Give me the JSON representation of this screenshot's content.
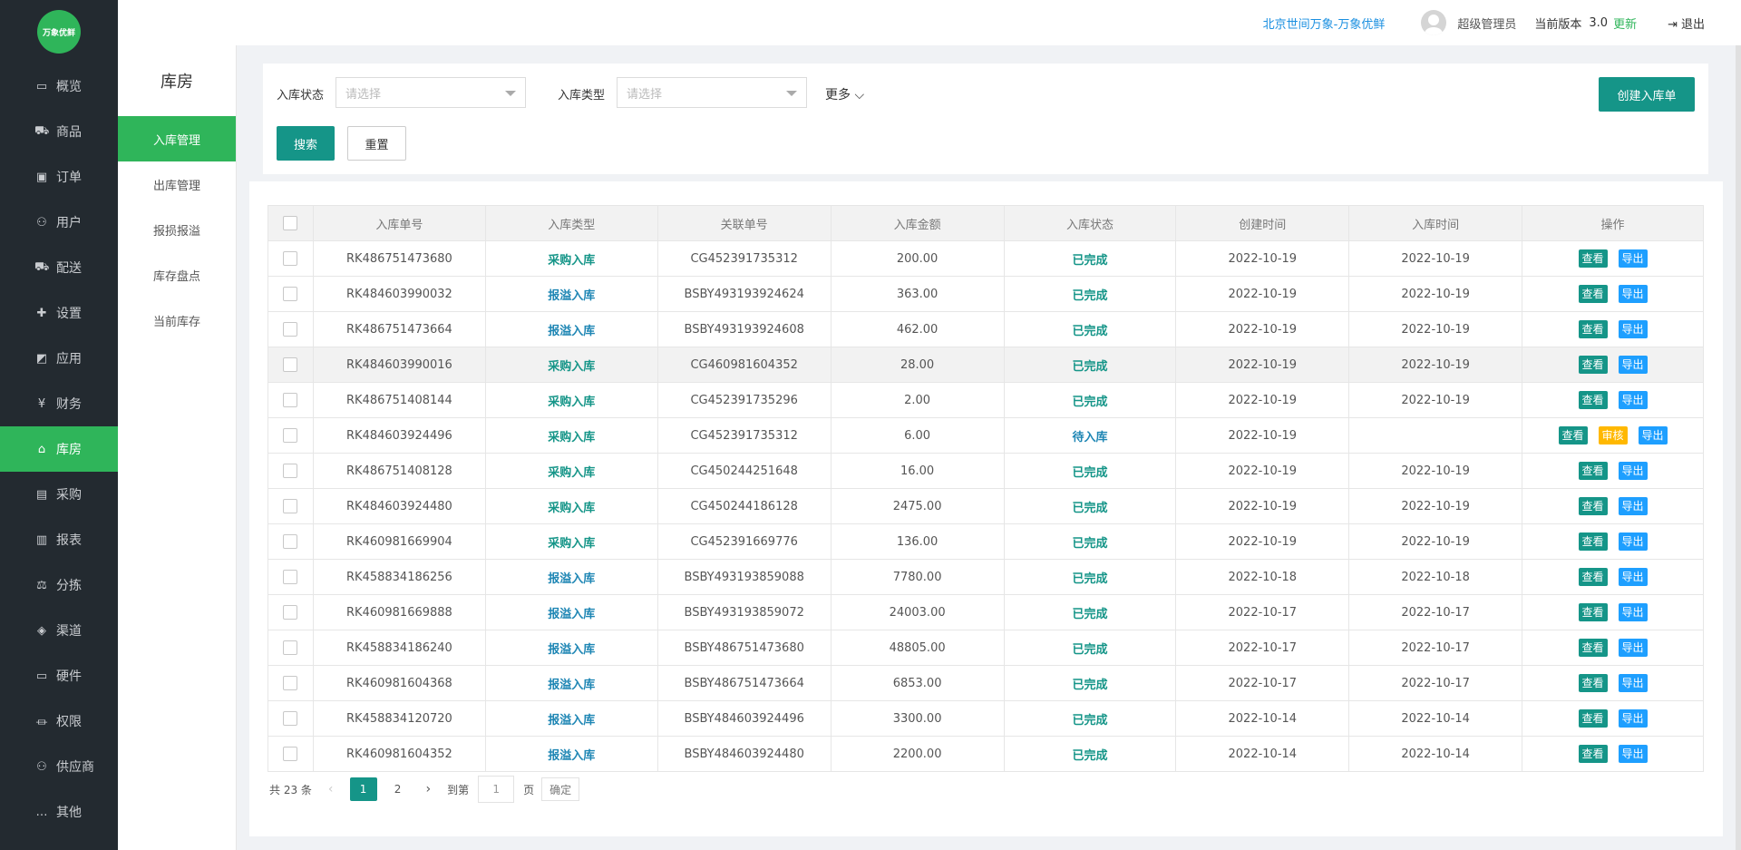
{
  "brand": {
    "logo_text": "万象优鲜"
  },
  "nav": [
    {
      "label": "概览",
      "icon": "monitor-icon"
    },
    {
      "label": "商品",
      "icon": "cart-icon"
    },
    {
      "label": "订单",
      "icon": "money-icon"
    },
    {
      "label": "用户",
      "icon": "users-icon"
    },
    {
      "label": "配送",
      "icon": "truck-icon"
    },
    {
      "label": "设置",
      "icon": "puzzle-icon"
    },
    {
      "label": "应用",
      "icon": "apps-icon"
    },
    {
      "label": "财务",
      "icon": "yen-icon"
    },
    {
      "label": "库房",
      "icon": "home-icon"
    },
    {
      "label": "采购",
      "icon": "bus-icon"
    },
    {
      "label": "报表",
      "icon": "bar-chart-icon"
    },
    {
      "label": "分拣",
      "icon": "scale-icon"
    },
    {
      "label": "渠道",
      "icon": "cube-icon"
    },
    {
      "label": "硬件",
      "icon": "desktop-icon"
    },
    {
      "label": "权限",
      "icon": "bank-icon"
    },
    {
      "label": "供应商",
      "icon": "users-icon"
    },
    {
      "label": "其他",
      "icon": "ellipsis-icon"
    }
  ],
  "subnav": {
    "title": "库房",
    "items": [
      "入库管理",
      "出库管理",
      "报损报溢",
      "库存盘点",
      "当前库存"
    ]
  },
  "header": {
    "org": "北京世间万象-万象优鲜",
    "user": "超级管理员",
    "version_label": "当前版本",
    "version": "3.0",
    "update": "更新",
    "logout": "退出"
  },
  "filters": {
    "status_label": "入库状态",
    "status_placeholder": "请选择",
    "type_label": "入库类型",
    "type_placeholder": "请选择",
    "more": "更多",
    "search": "搜索",
    "reset": "重置",
    "create": "创建入库单"
  },
  "table": {
    "headers": [
      "入库单号",
      "入库类型",
      "关联单号",
      "入库金额",
      "入库状态",
      "创建时间",
      "入库时间",
      "操作"
    ],
    "actions": {
      "view": "查看",
      "audit": "审核",
      "export": "导出"
    },
    "rows": [
      [
        "RK486751473680",
        "采购入库",
        "CG452391735312",
        "200.00",
        "已完成",
        "2022-10-19",
        "2022-10-19"
      ],
      [
        "RK484603990032",
        "报溢入库",
        "BSBY493193924624",
        "363.00",
        "已完成",
        "2022-10-19",
        "2022-10-19"
      ],
      [
        "RK486751473664",
        "报溢入库",
        "BSBY493193924608",
        "462.00",
        "已完成",
        "2022-10-19",
        "2022-10-19"
      ],
      [
        "RK484603990016",
        "采购入库",
        "CG460981604352",
        "28.00",
        "已完成",
        "2022-10-19",
        "2022-10-19"
      ],
      [
        "RK486751408144",
        "采购入库",
        "CG452391735296",
        "2.00",
        "已完成",
        "2022-10-19",
        "2022-10-19"
      ],
      [
        "RK484603924496",
        "采购入库",
        "CG452391735312",
        "6.00",
        "待入库",
        "2022-10-19",
        ""
      ],
      [
        "RK486751408128",
        "采购入库",
        "CG450244251648",
        "16.00",
        "已完成",
        "2022-10-19",
        "2022-10-19"
      ],
      [
        "RK484603924480",
        "采购入库",
        "CG450244186128",
        "2475.00",
        "已完成",
        "2022-10-19",
        "2022-10-19"
      ],
      [
        "RK460981669904",
        "采购入库",
        "CG452391669776",
        "136.00",
        "已完成",
        "2022-10-19",
        "2022-10-19"
      ],
      [
        "RK458834186256",
        "报溢入库",
        "BSBY493193859088",
        "7780.00",
        "已完成",
        "2022-10-18",
        "2022-10-18"
      ],
      [
        "RK460981669888",
        "报溢入库",
        "BSBY493193859072",
        "24003.00",
        "已完成",
        "2022-10-17",
        "2022-10-17"
      ],
      [
        "RK458834186240",
        "报溢入库",
        "BSBY486751473680",
        "48805.00",
        "已完成",
        "2022-10-17",
        "2022-10-17"
      ],
      [
        "RK460981604368",
        "报溢入库",
        "BSBY486751473664",
        "6853.00",
        "已完成",
        "2022-10-17",
        "2022-10-17"
      ],
      [
        "RK458834120720",
        "报溢入库",
        "BSBY484603924496",
        "3300.00",
        "已完成",
        "2022-10-14",
        "2022-10-14"
      ],
      [
        "RK460981604352",
        "报溢入库",
        "BSBY484603924480",
        "2200.00",
        "已完成",
        "2022-10-14",
        "2022-10-14"
      ]
    ]
  },
  "pagination": {
    "total": "共 23 条",
    "pages": [
      "1",
      "2"
    ],
    "goto": "到第",
    "goto_value": "1",
    "page_unit": "页",
    "confirm": "确定"
  },
  "colors": {
    "sidebar_bg": "#232a30",
    "active_green": "#2fb55a",
    "primary_teal": "#159588",
    "export_blue": "#1e9fff",
    "audit_yellow": "#ffb800",
    "link_blue": "#1a8fe0"
  }
}
